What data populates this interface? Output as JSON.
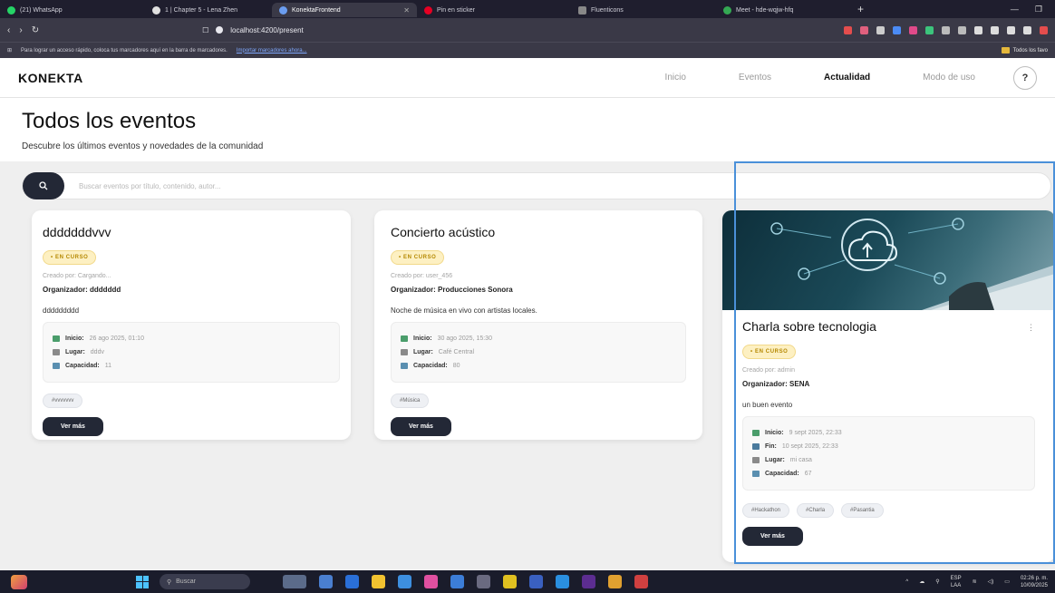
{
  "browser": {
    "tabs": [
      {
        "label": "(21) WhatsApp",
        "color": "#25d366",
        "active": false
      },
      {
        "label": "1 | Chapter 5 - Lena Zhen",
        "color": "#e0e0e0",
        "active": false
      },
      {
        "label": "KonektaFrontend",
        "color": "#6b9df0",
        "active": true
      },
      {
        "label": "Pin en sticker",
        "color": "#e60023",
        "active": false
      },
      {
        "label": "Fluenticons",
        "color": "#888888",
        "active": false
      },
      {
        "label": "Meet - hde-wqjw-hfq",
        "color": "#34a853",
        "active": false
      }
    ],
    "url": "localhost:4200/present",
    "bookmarks_text": "Para lograr un acceso rápido, coloca tus marcadores aquí en la barra de marcadores.",
    "bookmarks_link": "Importar marcadores ahora...",
    "all_favorites": "Todos los favo"
  },
  "app": {
    "brand": "KONEKTA",
    "nav": [
      {
        "label": "Inicio",
        "active": false
      },
      {
        "label": "Eventos",
        "active": false
      },
      {
        "label": "Actualidad",
        "active": true
      },
      {
        "label": "Modo de uso",
        "active": false
      }
    ],
    "help": "?"
  },
  "page": {
    "title": "Todos los eventos",
    "subtitle": "Descubre los últimos eventos y novedades de la comunidad"
  },
  "search": {
    "placeholder": "Buscar eventos por título, contenido, autor..."
  },
  "events": [
    {
      "title": "dddddddvvv",
      "status": "• EN CURSO",
      "created_by": "Creado por: Cargando...",
      "organizer_label": "Organizador:",
      "organizer": "ddddddd",
      "description": "ddddddddd",
      "details": [
        {
          "label": "Inicio:",
          "value": "26 ago 2025, 01:10",
          "icon": "calendar-icon"
        },
        {
          "label": "Lugar:",
          "value": "dddv",
          "icon": "location-icon"
        },
        {
          "label": "Capacidad:",
          "value": "11",
          "icon": "people-icon"
        }
      ],
      "tags": [
        "#vvvvvvv"
      ],
      "button": "Ver más"
    },
    {
      "title": "Concierto acústico",
      "status": "• EN CURSO",
      "created_by": "Creado por: user_456",
      "organizer_label": "Organizador:",
      "organizer": "Producciones Sonora",
      "description": "Noche de música en vivo con artistas locales.",
      "details": [
        {
          "label": "Inicio:",
          "value": "30 ago 2025, 15:30",
          "icon": "calendar-icon"
        },
        {
          "label": "Lugar:",
          "value": "Café Central",
          "icon": "location-icon"
        },
        {
          "label": "Capacidad:",
          "value": "80",
          "icon": "people-icon"
        }
      ],
      "tags": [
        "#Música"
      ],
      "button": "Ver más"
    },
    {
      "title": "Charla sobre tecnologia",
      "status": "• EN CURSO",
      "created_by": "Creado por: admin",
      "organizer_label": "Organizador:",
      "organizer": "SENA",
      "description": "un buen evento",
      "details": [
        {
          "label": "Inicio:",
          "value": "9 sept 2025, 22:33",
          "icon": "calendar-icon"
        },
        {
          "label": "Fin:",
          "value": "10 sept 2025, 22:33",
          "icon": "calendar-icon"
        },
        {
          "label": "Lugar:",
          "value": "mi casa",
          "icon": "location-icon"
        },
        {
          "label": "Capacidad:",
          "value": "67",
          "icon": "people-icon"
        }
      ],
      "tags": [
        "#Hackathon",
        "#Charla",
        "#Pasantia"
      ],
      "button": "Ver más",
      "menu": "⋮"
    }
  ],
  "taskbar": {
    "search": "Buscar",
    "lang": "ESP",
    "lang_sub": "LAA",
    "time": "02:26 p. m.",
    "date": "10/09/2025"
  },
  "colors": {
    "accent": "#232836",
    "badge_bg": "#fdf0c2",
    "badge_text": "#b58800",
    "selection": "#4a90d9"
  }
}
